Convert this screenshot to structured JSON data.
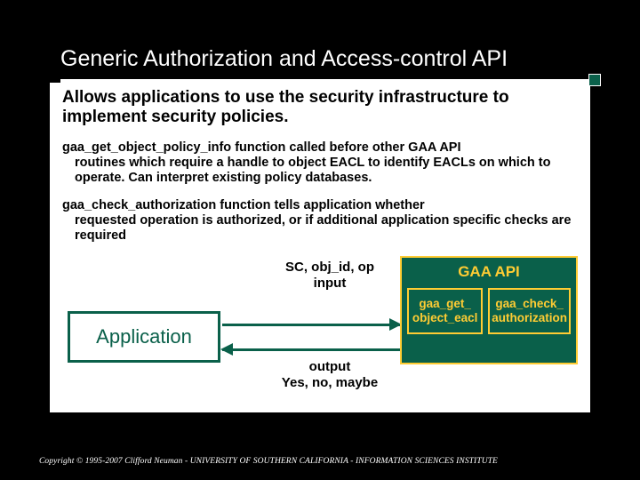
{
  "title": "Generic Authorization and Access-control API",
  "lead": "Allows applications to use the security infrastructure to implement security policies.",
  "para1": {
    "fn": "gaa_get_object_policy_info",
    "rest_line1": "  function called before other GAA API",
    "cont": "routines which require a handle to  object EACL to identify EACLs on which to operate. Can interpret existing policy databases."
  },
  "para2": {
    "fn": "gaa_check_authorization",
    "rest_line1": " function tells application whether",
    "cont": "requested operation is authorized, or if additional application specific checks are required"
  },
  "diagram": {
    "app_label": "Application",
    "input_label_l1": "SC, obj_id, op",
    "input_label_l2": "input",
    "output_label_l1": "output",
    "output_label_l2": "Yes, no, maybe",
    "api_title": "GAA  API",
    "cell1_l1": "gaa_get_",
    "cell1_l2": "object_eacl",
    "cell2_l1": "gaa_check_",
    "cell2_l2": "authorization"
  },
  "copyright": "Copyright © 1995-2007 Clifford Neuman - UNIVERSITY OF SOUTHERN CALIFORNIA - INFORMATION SCIENCES INSTITUTE"
}
